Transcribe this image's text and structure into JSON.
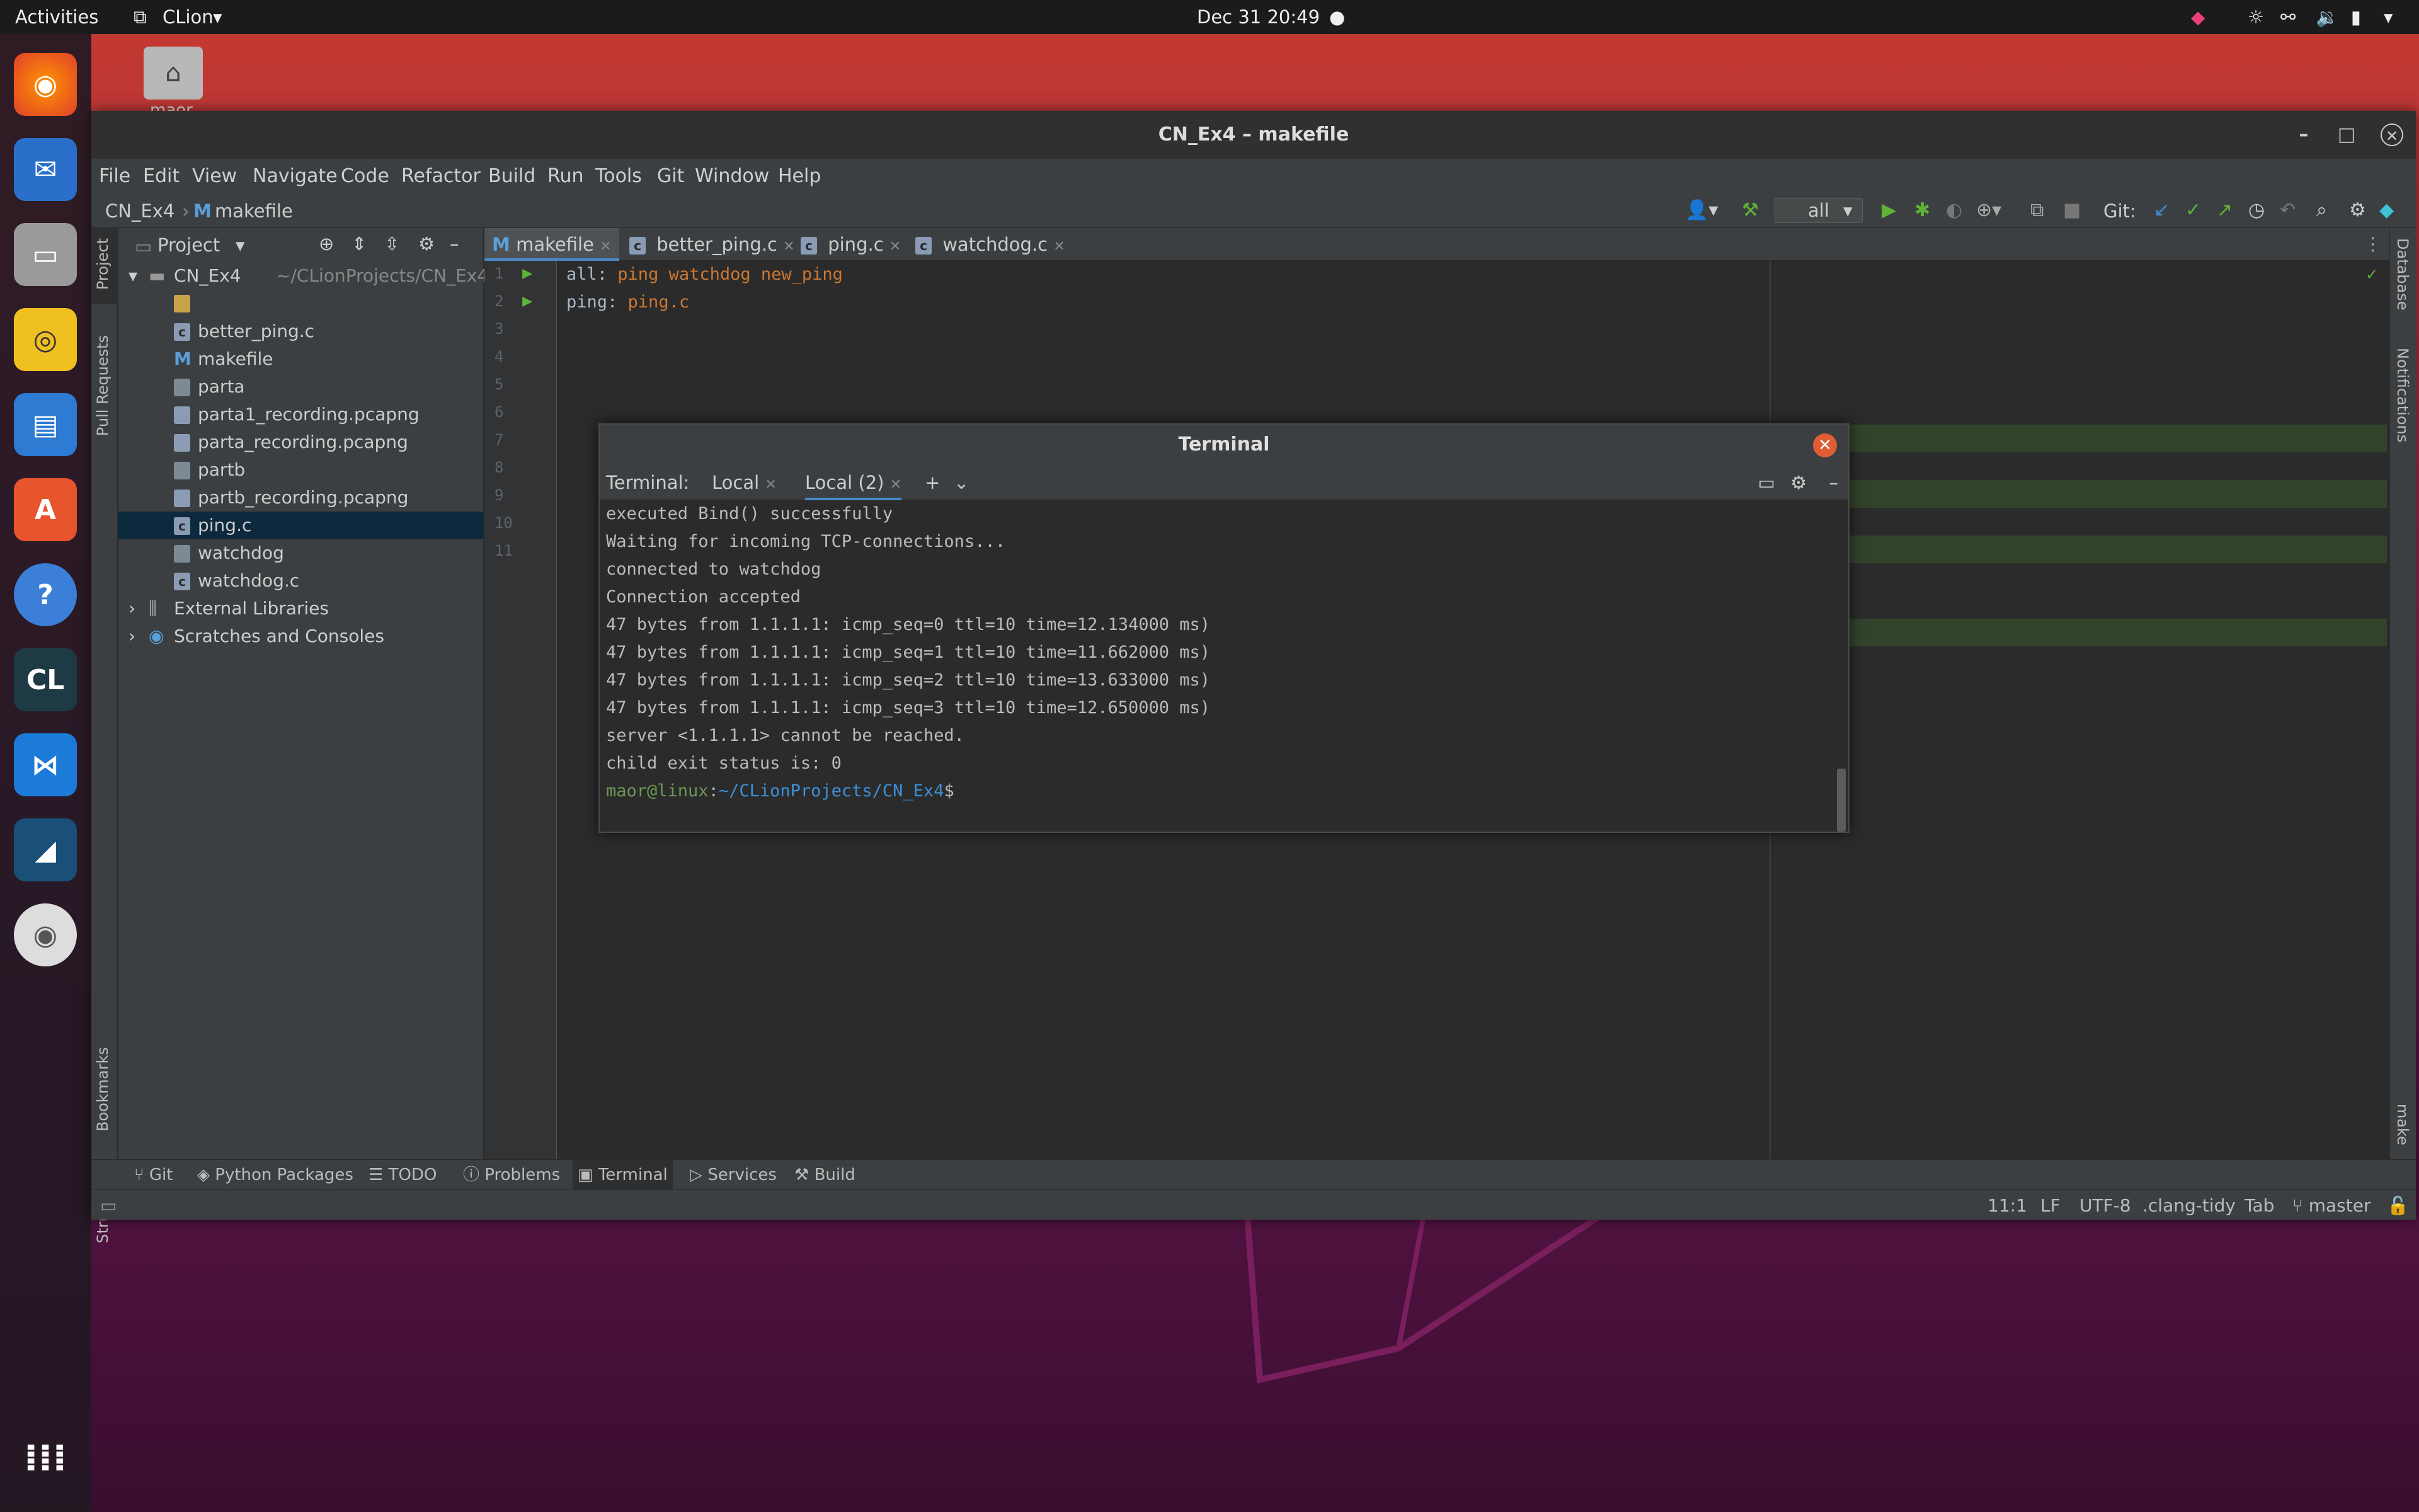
{
  "topbar": {
    "activities": "Activities",
    "app_name": "CLion",
    "datetime": "Dec 31  20:49"
  },
  "desktop": {
    "home_label": "maor"
  },
  "window": {
    "title": "CN_Ex4 – makefile"
  },
  "menu": {
    "items": [
      "File",
      "Edit",
      "View",
      "Navigate",
      "Code",
      "Refactor",
      "Build",
      "Run",
      "Tools",
      "Git",
      "Window",
      "Help"
    ]
  },
  "breadcrumb": {
    "project": "CN_Ex4",
    "file": "makefile"
  },
  "toolbar": {
    "config": "all",
    "git_label": "Git:"
  },
  "left_stripe": {
    "project": "Project",
    "pull_requests": "Pull Requests",
    "bookmarks": "Bookmarks",
    "structure": "Structure"
  },
  "right_stripe": {
    "database": "Database",
    "notifications": "Notifications",
    "make": "make"
  },
  "project_panel": {
    "title": "Project",
    "root_name": "CN_Ex4",
    "root_path": "~/CLionProjects/CN_Ex4",
    "files": [
      "better_ping.c",
      "makefile",
      "parta",
      "parta1_recording.pcapng",
      "parta_recording.pcapng",
      "partb",
      "partb_recording.pcapng",
      "ping.c",
      "watchdog",
      "watchdog.c"
    ],
    "external_libraries": "External Libraries",
    "scratches": "Scratches and Consoles"
  },
  "editor_tabs": [
    "makefile",
    "better_ping.c",
    "ping.c",
    "watchdog.c"
  ],
  "editor": {
    "line_numbers": [
      "1",
      "2",
      "3",
      "4",
      "5",
      "6",
      "7",
      "8",
      "9",
      "10",
      "11"
    ],
    "line1_target": "all:",
    "line1_deps": "ping watchdog new_ping",
    "line2_target": "ping:",
    "line2_deps": "ping.c"
  },
  "terminal": {
    "title": "Terminal",
    "label": "Terminal:",
    "tabs": [
      "Local",
      "Local (2)"
    ],
    "lines": [
      "executed Bind() successfully",
      "Waiting for incoming TCP-connections...",
      "connected to watchdog",
      "Connection accepted",
      "47 bytes from 1.1.1.1: icmp_seq=0 ttl=10 time=12.134000 ms)",
      "47 bytes from 1.1.1.1: icmp_seq=1 ttl=10 time=11.662000 ms)",
      "47 bytes from 1.1.1.1: icmp_seq=2 ttl=10 time=13.633000 ms)",
      "47 bytes from 1.1.1.1: icmp_seq=3 ttl=10 time=12.650000 ms)",
      "server <1.1.1.1> cannot be reached.",
      "child exit status is: 0"
    ],
    "prompt_user": "maor@linux",
    "prompt_sep": ":",
    "prompt_path": "~/CLionProjects/CN_Ex4",
    "prompt_end": "$"
  },
  "bottom_tools": [
    "Git",
    "Python Packages",
    "TODO",
    "Problems",
    "Terminal",
    "Services",
    "Build"
  ],
  "status": {
    "position": "11:1",
    "line_sep": "LF",
    "encoding": "UTF-8",
    "linter": ".clang-tidy",
    "indent": "Tab",
    "branch": "master"
  },
  "colors": {
    "accent": "#4a88c7",
    "prompt_user": "#6a9955",
    "prompt_path": "#3d8fd6",
    "make_keyword": "#cc7832"
  }
}
